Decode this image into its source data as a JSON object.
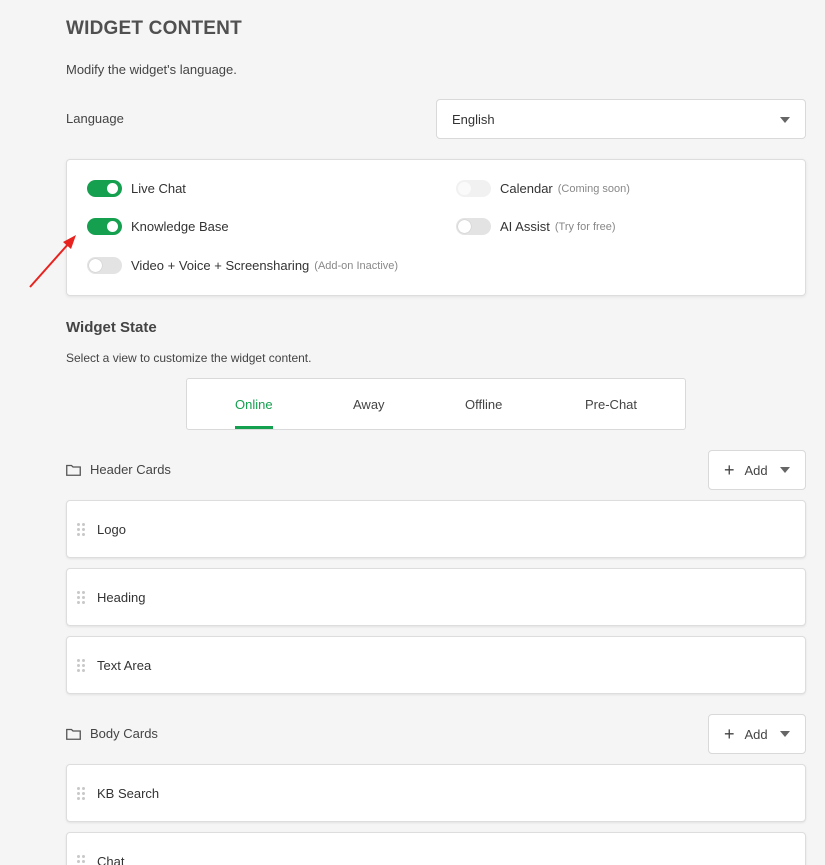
{
  "header": {
    "title": "WIDGET CONTENT",
    "subtitle": "Modify the widget's language."
  },
  "language": {
    "label": "Language",
    "selected": "English"
  },
  "features": [
    {
      "label": "Live Chat",
      "state": "on",
      "note": ""
    },
    {
      "label": "Knowledge Base",
      "state": "on",
      "note": ""
    },
    {
      "label": "Video + Voice + Screensharing",
      "state": "off",
      "note": "(Add-on Inactive)"
    },
    {
      "label": "Calendar",
      "state": "disabled",
      "note": "(Coming soon)"
    },
    {
      "label": "AI Assist",
      "state": "off",
      "note": "(Try for free)"
    }
  ],
  "widget_state": {
    "heading": "Widget State",
    "description": "Select a view to customize the widget content.",
    "tabs": [
      "Online",
      "Away",
      "Offline",
      "Pre-Chat"
    ],
    "active_tab": "Online"
  },
  "header_cards": {
    "label": "Header Cards",
    "add_label": "Add",
    "items": [
      "Logo",
      "Heading",
      "Text Area"
    ]
  },
  "body_cards": {
    "label": "Body Cards",
    "add_label": "Add",
    "items": [
      "KB Search",
      "Chat"
    ]
  },
  "colors": {
    "accent": "#15a04f",
    "annotation_arrow": "#e8231f"
  }
}
